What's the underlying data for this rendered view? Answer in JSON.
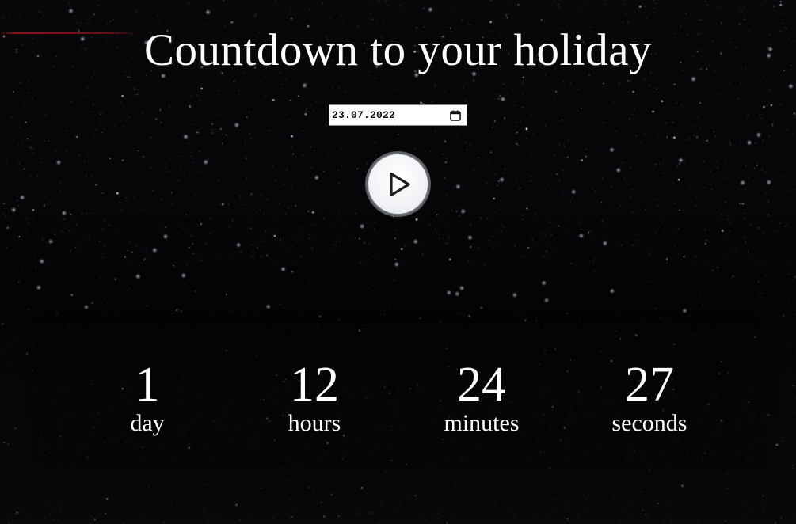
{
  "page": {
    "title": "Countdown to your holiday"
  },
  "date_input": {
    "value": "23.07.2022",
    "icon": "calendar-icon"
  },
  "start_button": {
    "icon": "play-icon"
  },
  "countdown": {
    "days": {
      "value": "1",
      "label": "day"
    },
    "hours": {
      "value": "12",
      "label": "hours"
    },
    "minutes": {
      "value": "24",
      "label": "minutes"
    },
    "seconds": {
      "value": "27",
      "label": "seconds"
    }
  },
  "colors": {
    "background": "#050507",
    "text": "#ffffff",
    "button_border": "#6f7680"
  }
}
